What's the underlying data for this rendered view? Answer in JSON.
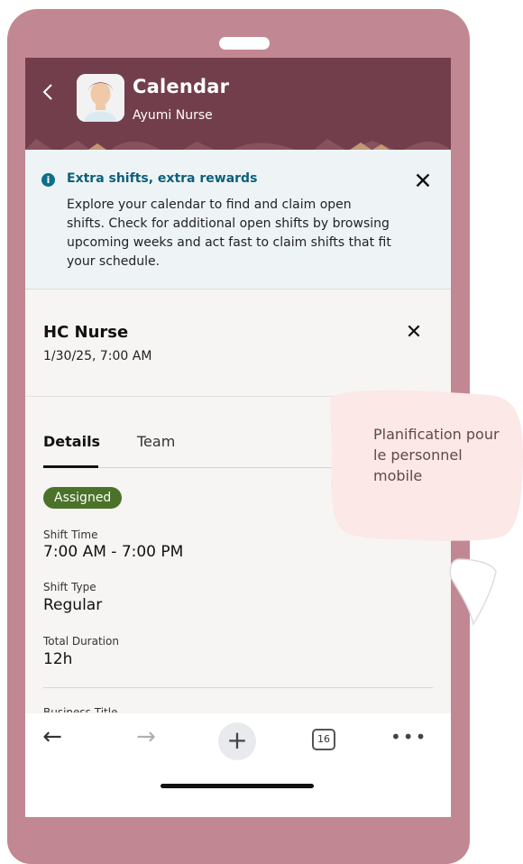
{
  "header": {
    "title": "Calendar",
    "subtitle": "Ayumi Nurse"
  },
  "banner": {
    "title": "Extra shifts, extra rewards",
    "text": "Explore your calendar to find and claim open shifts. Check for additional open shifts by browsing upcoming weeks and act fast to claim shifts that fit your schedule.",
    "close_label": "✕"
  },
  "shift": {
    "title": "HC Nurse",
    "datetime": "1/30/25, 7:00 AM",
    "close_label": "✕"
  },
  "tabs": [
    {
      "label": "Details",
      "active": true
    },
    {
      "label": "Team",
      "active": false
    }
  ],
  "details": {
    "status": "Assigned",
    "fields": [
      {
        "label": "Shift Time",
        "value": "7:00 AM - 7:00 PM"
      },
      {
        "label": "Shift Type",
        "value": "Regular"
      },
      {
        "label": "Total Duration",
        "value": "12h"
      }
    ],
    "next_label": "Business Title"
  },
  "browser_bar": {
    "back": "←",
    "forward": "→",
    "add": "+",
    "tab_count": "16",
    "more": "•••"
  },
  "overlay": {
    "bubble_text": "Planification pour le personnel mobile"
  },
  "colors": {
    "frame": "#c18893",
    "header": "#733e4c",
    "banner_bg": "#eef4f6",
    "banner_title": "#0d5f7b",
    "badge": "#4a7229",
    "bubble": "#fbe8e7"
  }
}
